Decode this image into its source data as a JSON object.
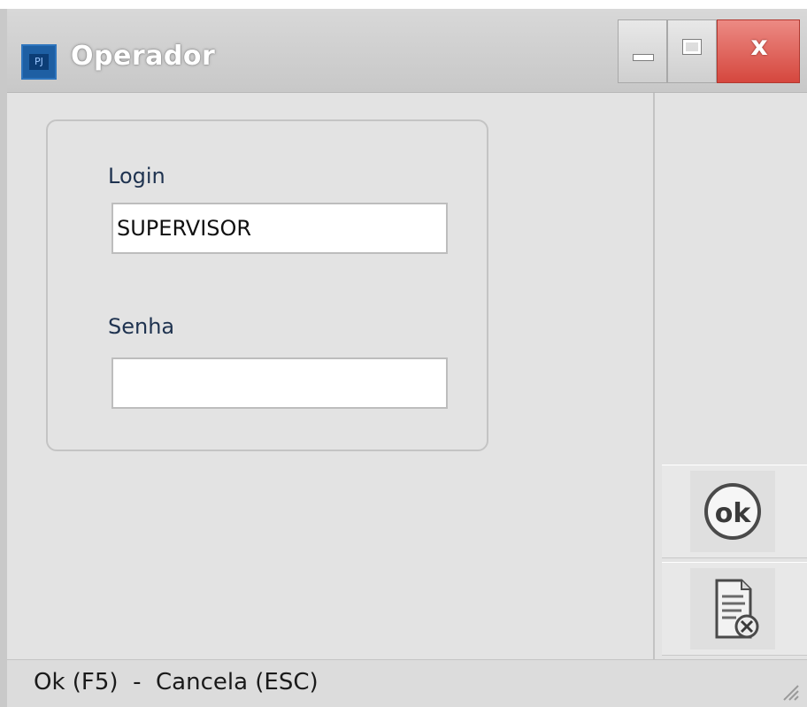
{
  "window": {
    "title": "Operador",
    "app_icon": "app-logo-icon",
    "app_icon_text": "PJ",
    "controls": {
      "minimize_icon": "minimize-icon",
      "maximize_icon": "maximize-icon",
      "close_icon": "close-icon",
      "close_glyph": "x"
    }
  },
  "form": {
    "login_label": "Login",
    "login_value": "SUPERVISOR",
    "password_label": "Senha",
    "password_value": ""
  },
  "actions": {
    "ok_icon": "ok-icon",
    "ok_text": "ok",
    "cancel_icon": "cancel-document-icon"
  },
  "status": {
    "text": "Ok (F5)  -  Cancela (ESC)"
  },
  "colors": {
    "window_bg": "#e3e3e3",
    "close_button": "#d5473e",
    "app_icon": "#1e5fa3",
    "label_text": "#1f3350"
  }
}
